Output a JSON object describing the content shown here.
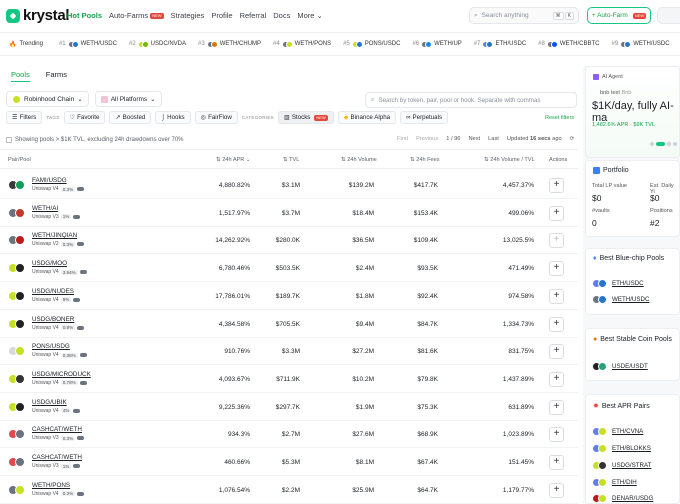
{
  "brand": {
    "name": "krystal"
  },
  "nav": {
    "items": [
      "Hot Pools",
      "Auto-Farms",
      "Strategies",
      "Profile",
      "Referral",
      "Docs",
      "More"
    ],
    "new_badge": "NEW"
  },
  "search": {
    "placeholder": "Search anything",
    "shortcut": [
      "⌘",
      "K"
    ]
  },
  "autofarm_button": "+ Auto-Farm",
  "trending": {
    "label": "Trending",
    "items": [
      {
        "rank": "#1",
        "pair": "WETH/USDC"
      },
      {
        "rank": "#2",
        "pair": "USDC/NVDA"
      },
      {
        "rank": "#3",
        "pair": "WETH/CHUMP"
      },
      {
        "rank": "#4",
        "pair": "WETH/PONS"
      },
      {
        "rank": "#5",
        "pair": "PONS/USDC"
      },
      {
        "rank": "#6",
        "pair": "WETH/UP"
      },
      {
        "rank": "#7",
        "pair": "ETH/USDC"
      },
      {
        "rank": "#8",
        "pair": "WETH/CBBTC"
      },
      {
        "rank": "#9",
        "pair": "WETH/USDC"
      }
    ]
  },
  "tabs": [
    "Pools",
    "Farms"
  ],
  "chain_select": "Robinhood Chain",
  "platform_select": "All Platforms",
  "pool_search": {
    "placeholder": "Search by token, pair, pool or hook. Separate with commas"
  },
  "filter_bar": {
    "filters": "Filters",
    "tags_label": "TAGS",
    "tags": [
      "Favorite",
      "Boosted",
      "Hooks",
      "FairFlow"
    ],
    "categories_label": "CATEGORIES",
    "categories": [
      "Stocks",
      "Binance Alpha",
      "Perpetuals"
    ],
    "reset": "Reset filters"
  },
  "showing": "Showing pools > $1K TVL, excluding 24h drawdowns over 70%",
  "pager": {
    "first": "First",
    "previous": "Previous",
    "page": "1 / 96",
    "next": "Next",
    "last": "Last",
    "updated_prefix": "Updated",
    "updated_value": "16 secs",
    "updated_suffix": "ago"
  },
  "table": {
    "headers": [
      "Pair/Pool",
      "24h APR",
      "TVL",
      "24h Volume",
      "24h Fees",
      "24h Volume / TVL",
      "Actions"
    ],
    "rows": [
      {
        "pair": "FAMI/USDG",
        "dex": "Uniswap V4",
        "fee": "0.3%",
        "apr": "4,880.82%",
        "tvl": "$3.1M",
        "volume": "$139.2M",
        "fees": "$417.7K",
        "ratio": "4,457.37%",
        "c1": "#3a3a3a",
        "c2": "#0f9d58",
        "add_enabled": true
      },
      {
        "pair": "WETH/AI",
        "dex": "Uniswap V3",
        "fee": "1%",
        "apr": "1,517.97%",
        "tvl": "$3.7M",
        "volume": "$18.4M",
        "fees": "$153.4K",
        "ratio": "499.06%",
        "c1": "#6b7280",
        "c2": "#c0392b",
        "add_enabled": true
      },
      {
        "pair": "WETH/JINQIAN",
        "dex": "Uniswap V2",
        "fee": "0.3%",
        "apr": "14,262.92%",
        "tvl": "$280.0K",
        "volume": "$36.5M",
        "fees": "$109.4K",
        "ratio": "13,025.5%",
        "c1": "#6b7280",
        "c2": "#b91c1c",
        "add_enabled": false
      },
      {
        "pair": "USDG/MOO",
        "dex": "Uniswap V4",
        "fee": "3.94%",
        "apr": "6,780.46%",
        "tvl": "$503.5K",
        "volume": "$2.4M",
        "fees": "$93.5K",
        "ratio": "471.49%",
        "c1": "#c6e025",
        "c2": "#222",
        "add_enabled": true
      },
      {
        "pair": "USDG/NUDES",
        "dex": "Uniswap V4",
        "fee": "5%",
        "apr": "17,786.01%",
        "tvl": "$189.7K",
        "volume": "$1.8M",
        "fees": "$92.4K",
        "ratio": "974.58%",
        "c1": "#c6e025",
        "c2": "#222",
        "add_enabled": true
      },
      {
        "pair": "USDG/BONER",
        "dex": "Uniswap V4",
        "fee": "0.9%",
        "apr": "4,384.58%",
        "tvl": "$705.5K",
        "volume": "$9.4M",
        "fees": "$84.7K",
        "ratio": "1,334.73%",
        "c1": "#c6e025",
        "c2": "#222",
        "add_enabled": true
      },
      {
        "pair": "PONS/USDG",
        "dex": "Uniswap V4",
        "fee": "0.36%",
        "apr": "910.76%",
        "tvl": "$3.3M",
        "volume": "$27.2M",
        "fees": "$81.6K",
        "ratio": "831.75%",
        "c1": "#d8d8d8",
        "c2": "#c6e025",
        "add_enabled": true
      },
      {
        "pair": "USDG/MICRODUCK",
        "dex": "Uniswap V4",
        "fee": "0.78%",
        "apr": "4,093.67%",
        "tvl": "$711.9K",
        "volume": "$10.2M",
        "fees": "$79.8K",
        "ratio": "1,437.89%",
        "c1": "#c6e025",
        "c2": "#333",
        "add_enabled": true
      },
      {
        "pair": "USDG/UBIK",
        "dex": "Uniswap V4",
        "fee": "4%",
        "apr": "9,225.36%",
        "tvl": "$297.7K",
        "volume": "$1.9M",
        "fees": "$75.3K",
        "ratio": "631.89%",
        "c1": "#c6e025",
        "c2": "#222",
        "add_enabled": true
      },
      {
        "pair": "CASHCAT/WETH",
        "dex": "Uniswap V3",
        "fee": "0.3%",
        "apr": "934.3%",
        "tvl": "$2.7M",
        "volume": "$27.6M",
        "fees": "$68.9K",
        "ratio": "1,023.89%",
        "c1": "#e04a4a",
        "c2": "#6b7280",
        "add_enabled": true
      },
      {
        "pair": "CASHCAT/WETH",
        "dex": "Uniswap V3",
        "fee": "1%",
        "apr": "460.66%",
        "tvl": "$5.3M",
        "volume": "$8.1M",
        "fees": "$67.4K",
        "ratio": "151.45%",
        "c1": "#e04a4a",
        "c2": "#6b7280",
        "add_enabled": true
      },
      {
        "pair": "WETH/PONS",
        "dex": "Uniswap V4",
        "fee": "0.3%",
        "apr": "1,076.54%",
        "tvl": "$2.2M",
        "volume": "$25.9M",
        "fees": "$64.7K",
        "ratio": "1,179.77%",
        "c1": "#6b7280",
        "c2": "#c6e025",
        "add_enabled": true
      }
    ]
  },
  "sidebar": {
    "ai_agent": {
      "label": "AI Agent",
      "sub": "bnb test",
      "sub2": "Bnb",
      "headline": "$1K/day, fully AI-ma",
      "stats": "1,482.6% APR · $9K TVL"
    },
    "portfolio": {
      "title": "Portfolio",
      "lp_label": "Total LP value",
      "lp_value": "$0",
      "daily_label": "Est. Daily Yi",
      "daily_value": "$0",
      "vaults_label": "#vaults",
      "vaults_value": "0",
      "positions_label": "Positions",
      "positions_value": "#2"
    },
    "bluechip": {
      "title": "Best Blue-chip Pools",
      "items": [
        "ETH/USDC",
        "WETH/USDC"
      ]
    },
    "stable": {
      "title": "Best Stable Coin Pools",
      "items": [
        "USDE/USDT"
      ]
    },
    "best_apr": {
      "title": "Best APR Pairs",
      "items": [
        "ETH/CVNA",
        "ETH/BLOKKS",
        "USDG/STRAT",
        "ETH/DIH",
        "DENAR/USDG"
      ]
    }
  },
  "colors": {
    "accent": "#16c784",
    "accent_text": "#16a34a",
    "badge": "#e5483b"
  }
}
